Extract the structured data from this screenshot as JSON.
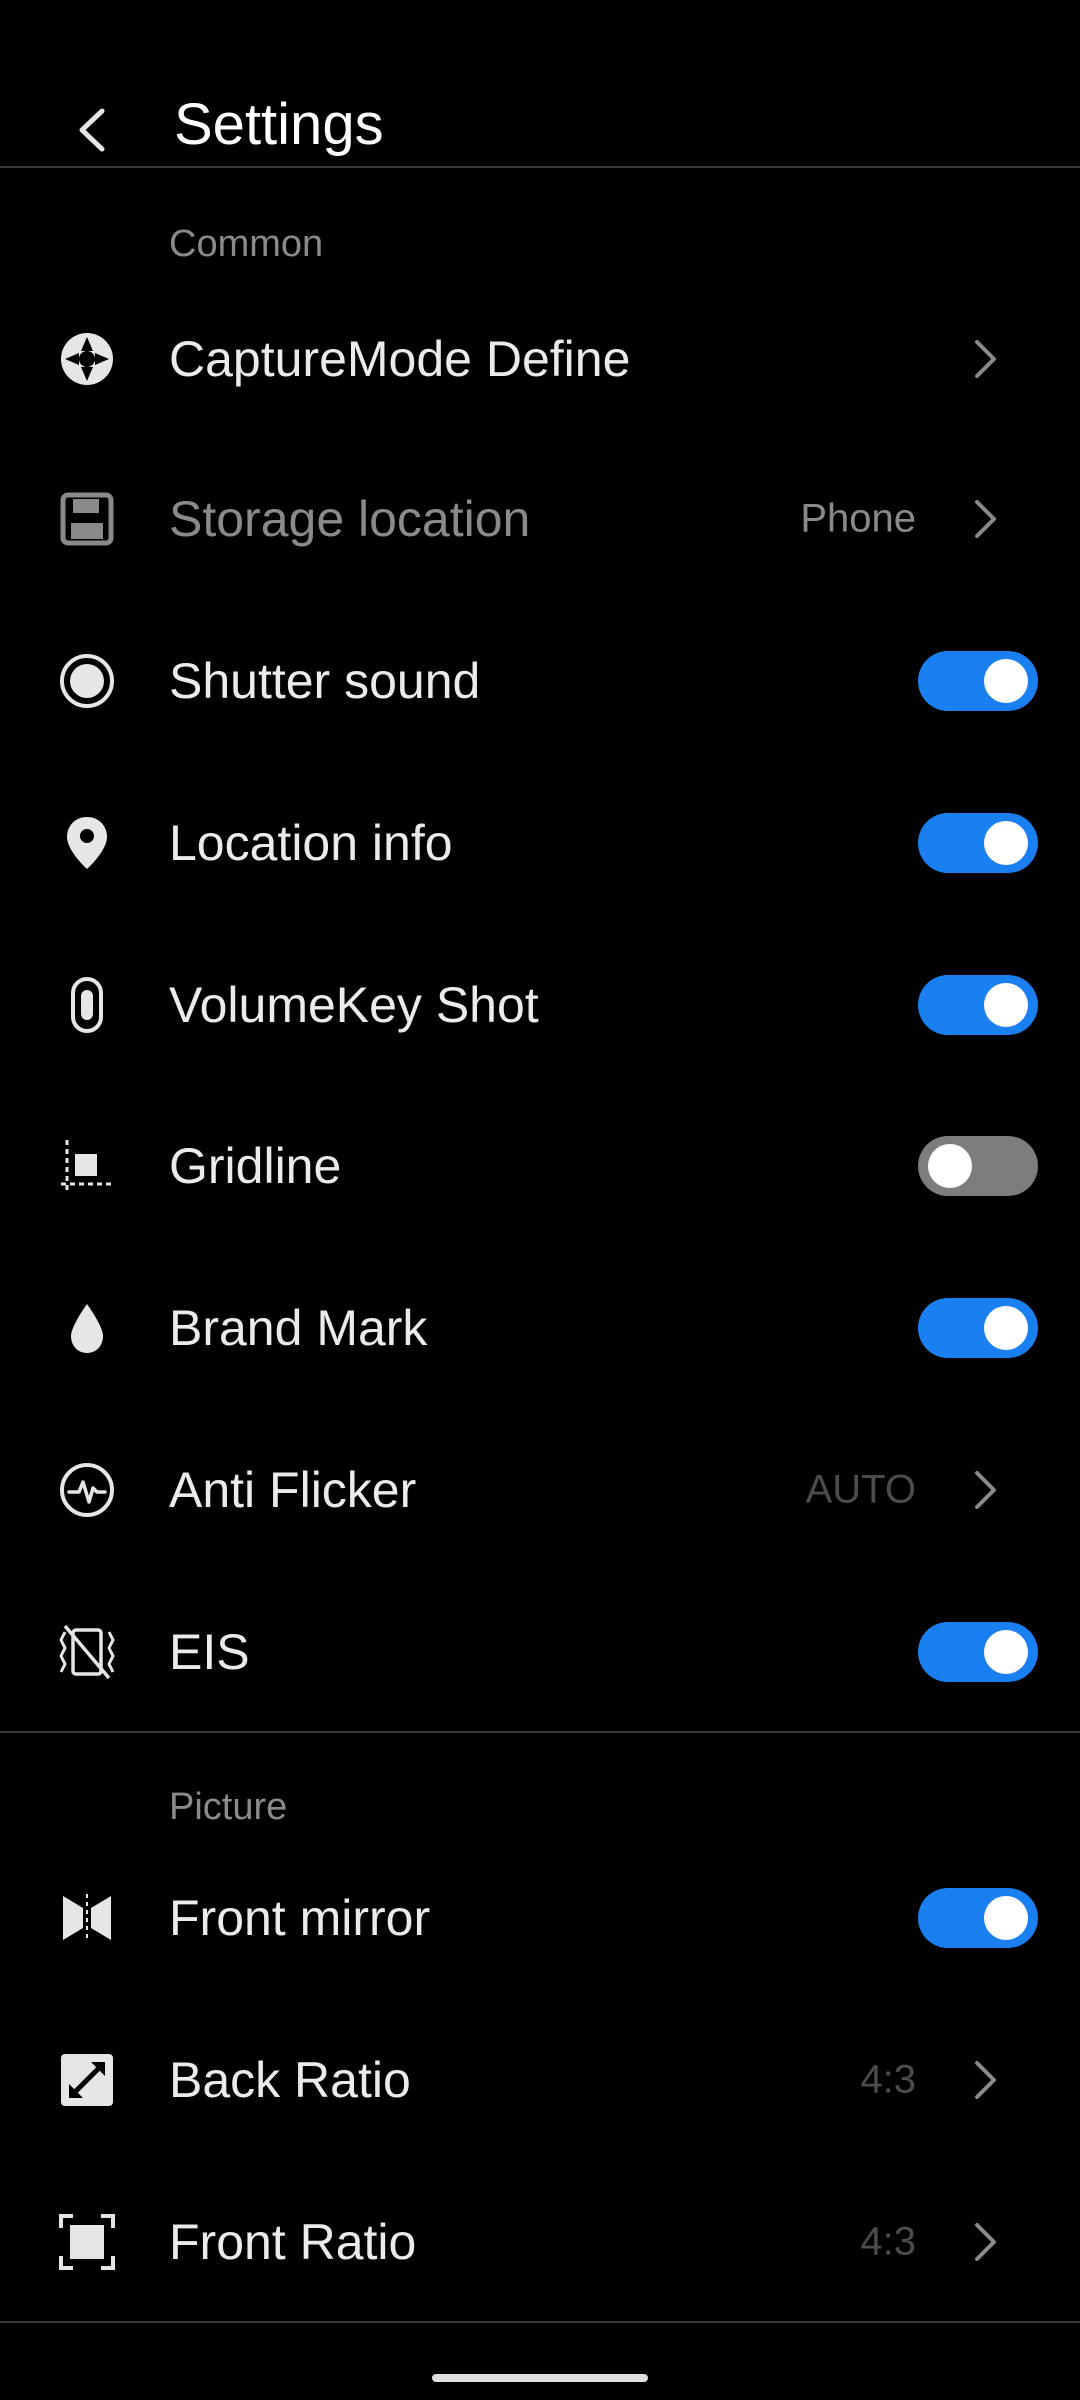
{
  "header": {
    "title": "Settings"
  },
  "sections": {
    "common": "Common",
    "picture": "Picture"
  },
  "rows": {
    "capture_mode": {
      "label": "CaptureMode Define"
    },
    "storage": {
      "label": "Storage location",
      "value": "Phone"
    },
    "shutter": {
      "label": "Shutter sound",
      "on": true
    },
    "location": {
      "label": "Location info",
      "on": true
    },
    "volume": {
      "label": "VolumeKey Shot",
      "on": true
    },
    "gridline": {
      "label": "Gridline",
      "on": false
    },
    "brand": {
      "label": "Brand Mark",
      "on": true
    },
    "flicker": {
      "label": "Anti Flicker",
      "value": "AUTO"
    },
    "eis": {
      "label": "EIS",
      "on": true
    },
    "mirror": {
      "label": "Front mirror",
      "on": true
    },
    "back_ratio": {
      "label": "Back Ratio",
      "value": "4:3"
    },
    "front_ratio": {
      "label": "Front Ratio",
      "value": "4:3"
    }
  },
  "colors": {
    "accent": "#1a7ff0",
    "toggle_off": "#7d7d7d",
    "background": "#000000"
  },
  "icons": {
    "back": "back-arrow-icon",
    "capture_mode": "aperture-icon",
    "storage": "floppy-disk-icon",
    "shutter": "shutter-circle-icon",
    "location": "location-pin-icon",
    "volume": "volume-key-icon",
    "gridline": "gridline-icon",
    "brand": "drop-icon",
    "flicker": "pulse-circle-icon",
    "eis": "stabilization-icon",
    "mirror": "mirror-icon",
    "back_ratio": "resize-arrow-icon",
    "front_ratio": "frame-icon",
    "chevron": "chevron-right-icon"
  }
}
